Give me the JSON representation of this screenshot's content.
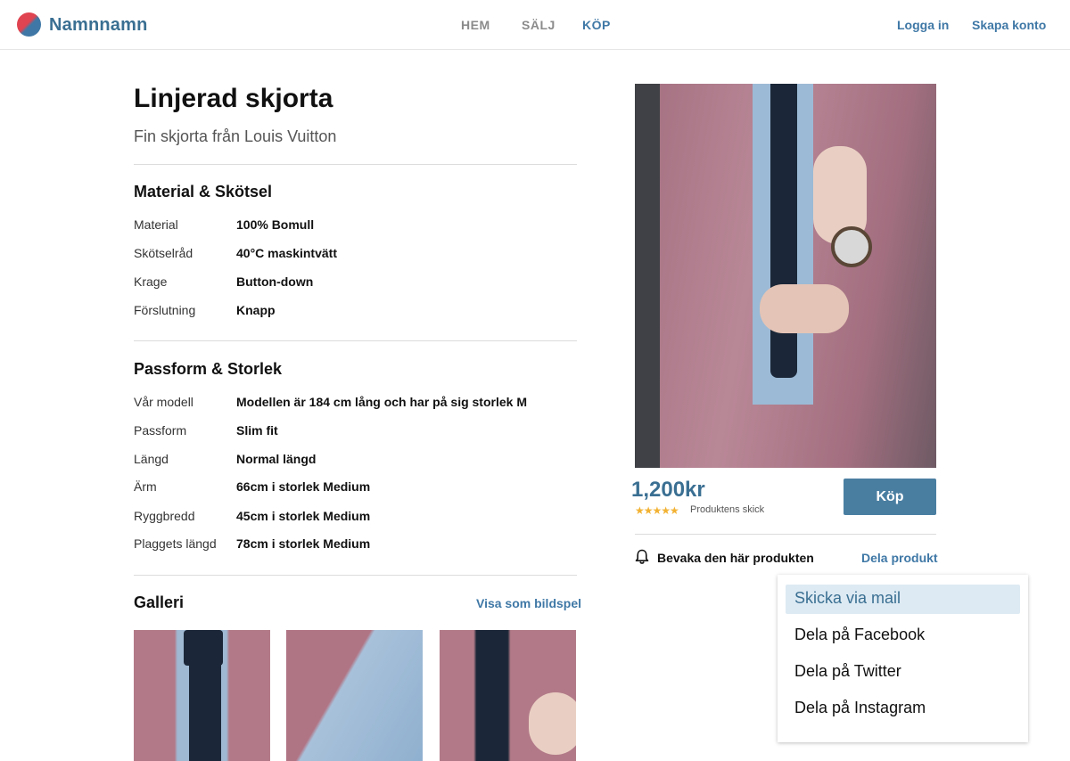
{
  "header": {
    "brand": "Namnnamn",
    "nav": [
      "HEM",
      "SÄLJ",
      "KÖP"
    ],
    "login": "Logga in",
    "signup": "Skapa konto"
  },
  "product": {
    "title": "Linjerad skjorta",
    "subtitle": "Fin skjorta från Louis Vuitton",
    "price": "1,200kr",
    "rating_stars": "★★★★★",
    "rating_caption": "Produktens skick",
    "buy_label": "Köp",
    "watch_label": "Bevaka den här produkten",
    "share_label": "Dela produkt"
  },
  "material": {
    "heading": "Material & Skötsel",
    "rows": [
      {
        "label": "Material",
        "value": "100% Bomull"
      },
      {
        "label": "Skötselråd",
        "value": "40°C maskintvätt"
      },
      {
        "label": "Krage",
        "value": "Button-down"
      },
      {
        "label": "Förslutning",
        "value": "Knapp"
      }
    ]
  },
  "fit": {
    "heading": "Passform & Storlek",
    "rows": [
      {
        "label": "Vår modell",
        "value": "Modellen är 184 cm lång och har på sig storlek M"
      },
      {
        "label": "Passform",
        "value": "Slim fit"
      },
      {
        "label": "Längd",
        "value": "Normal längd"
      },
      {
        "label": "Ärm",
        "value": "66cm i storlek Medium"
      },
      {
        "label": "Ryggbredd",
        "value": "45cm i storlek Medium"
      },
      {
        "label": "Plaggets längd",
        "value": "78cm i storlek Medium"
      }
    ]
  },
  "gallery": {
    "heading": "Galleri",
    "slideshow_link": "Visa som bildspel"
  },
  "share_menu": {
    "items": [
      "Skicka via mail",
      "Dela på Facebook",
      "Dela på Twitter",
      "Dela på Instagram"
    ],
    "active_index": 0
  },
  "colors": {
    "accent": "#3f78a6",
    "brand": "#3a6f92",
    "button": "#4a7ea1",
    "star": "#f2b233",
    "menu_highlight": "#ddeaf3"
  },
  "icons": {
    "logo": "logo-icon",
    "bell": "bell-icon",
    "star": "star-icon"
  }
}
